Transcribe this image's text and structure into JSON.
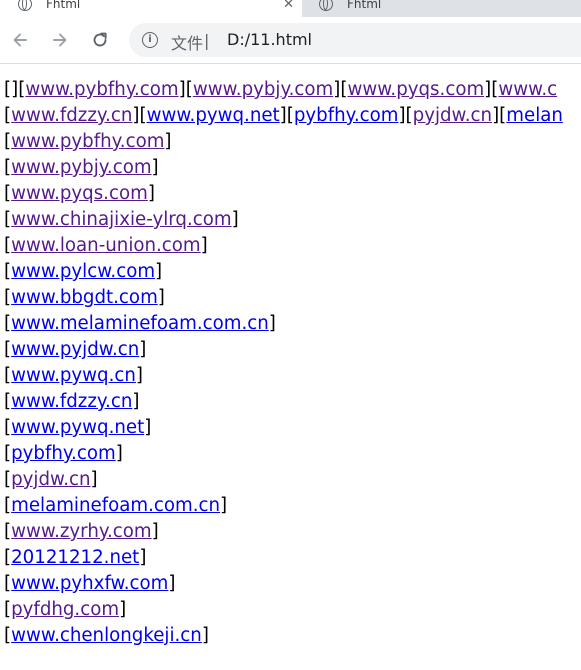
{
  "browser": {
    "tabs": [
      {
        "title": "Fhtml",
        "active": true
      },
      {
        "title": "Fhtml",
        "active": false
      }
    ],
    "address_bar": {
      "scheme_label": "文件",
      "separator": "|",
      "url": "D:/11.html"
    }
  },
  "page": {
    "first_line": {
      "prefix": "[]",
      "links": [
        {
          "text": "www.pybfhy.com",
          "visited": true
        },
        {
          "text": "www.pybjy.com",
          "visited": true
        },
        {
          "text": "www.pyqs.com",
          "visited": true
        },
        {
          "text": "www.c",
          "visited": true
        }
      ]
    },
    "second_line": {
      "links": [
        {
          "text": "www.fdzzy.cn",
          "visited": true
        },
        {
          "text": "www.pywq.net",
          "visited": false
        },
        {
          "text": "pybfhy.com",
          "visited": false
        },
        {
          "text": "pyjdw.cn",
          "visited": true
        },
        {
          "text": "melan",
          "visited": false
        }
      ]
    },
    "list": [
      {
        "text": "www.pybfhy.com",
        "visited": true
      },
      {
        "text": "www.pybjy.com",
        "visited": true
      },
      {
        "text": "www.pyqs.com",
        "visited": true
      },
      {
        "text": "www.chinajixie-ylrq.com",
        "visited": true
      },
      {
        "text": "www.loan-union.com",
        "visited": true
      },
      {
        "text": "www.pylcw.com",
        "visited": false
      },
      {
        "text": "www.bbgdt.com",
        "visited": false
      },
      {
        "text": "www.melaminefoam.com.cn",
        "visited": false
      },
      {
        "text": "www.pyjdw.cn",
        "visited": false
      },
      {
        "text": "www.pywq.cn",
        "visited": false
      },
      {
        "text": "www.fdzzy.cn",
        "visited": false
      },
      {
        "text": "www.pywq.net",
        "visited": false
      },
      {
        "text": "pybfhy.com",
        "visited": false
      },
      {
        "text": "pyjdw.cn",
        "visited": true
      },
      {
        "text": "melaminefoam.com.cn",
        "visited": false
      },
      {
        "text": "www.zyrhy.com",
        "visited": true
      },
      {
        "text": "20121212.net",
        "visited": false
      },
      {
        "text": "www.pyhxfw.com",
        "visited": false
      },
      {
        "text": "pyfdhg.com",
        "visited": true
      },
      {
        "text": "www.chenlongkeji.cn",
        "visited": false
      }
    ]
  },
  "colors": {
    "link_unvisited": "#0000ee",
    "link_visited": "#551a8b",
    "tab_strip": "#dee1e6",
    "omnibox": "#f1f3f4"
  },
  "icons": [
    "globe-icon",
    "close-icon",
    "back-arrow-icon",
    "forward-arrow-icon",
    "reload-icon",
    "info-icon"
  ]
}
